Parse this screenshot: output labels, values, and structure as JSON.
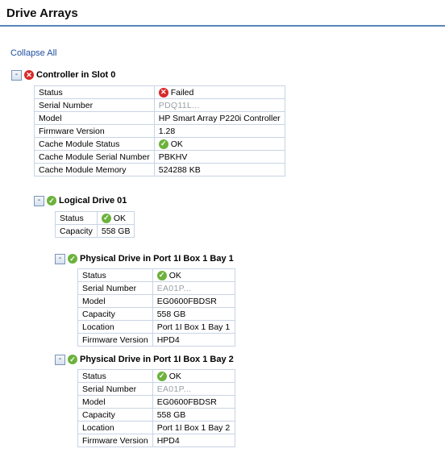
{
  "page": {
    "title": "Drive Arrays",
    "collapse_all": "Collapse All"
  },
  "controller": {
    "toggle": "-",
    "label": "Controller in Slot 0",
    "props": {
      "status_key": "Status",
      "status_val": "Failed",
      "serial_key": "Serial Number",
      "serial_val": "PDQ11L...",
      "model_key": "Model",
      "model_val": "HP Smart Array P220i Controller",
      "firmware_key": "Firmware Version",
      "firmware_val": "1.28",
      "cache_status_key": "Cache Module Status",
      "cache_status_val": "OK",
      "cache_serial_key": "Cache Module Serial Number",
      "cache_serial_val": "PBKHV",
      "cache_memory_key": "Cache Module Memory",
      "cache_memory_val": "524288 KB"
    }
  },
  "logical_drive": {
    "toggle": "-",
    "label": "Logical Drive 01",
    "props": {
      "status_key": "Status",
      "status_val": "OK",
      "capacity_key": "Capacity",
      "capacity_val": "558 GB"
    }
  },
  "physical_drives": [
    {
      "toggle": "-",
      "label": "Physical Drive in Port 1I Box 1 Bay 1",
      "props": {
        "status_key": "Status",
        "status_val": "OK",
        "serial_key": "Serial Number",
        "serial_val": "EA01P...",
        "model_key": "Model",
        "model_val": "EG0600FBDSR",
        "capacity_key": "Capacity",
        "capacity_val": "558 GB",
        "location_key": "Location",
        "location_val": "Port 1I Box 1 Bay 1",
        "firmware_key": "Firmware Version",
        "firmware_val": "HPD4"
      }
    },
    {
      "toggle": "-",
      "label": "Physical Drive in Port 1I Box 1 Bay 2",
      "props": {
        "status_key": "Status",
        "status_val": "OK",
        "serial_key": "Serial Number",
        "serial_val": "EA01P...",
        "model_key": "Model",
        "model_val": "EG0600FBDSR",
        "capacity_key": "Capacity",
        "capacity_val": "558 GB",
        "location_key": "Location",
        "location_val": "Port 1I Box 1 Bay 2",
        "firmware_key": "Firmware Version",
        "firmware_val": "HPD4"
      }
    }
  ],
  "icons": {
    "failed": "error-x-icon",
    "ok": "check-circle-icon"
  },
  "colors": {
    "failed": "#d62a2a",
    "ok": "#6cb23c",
    "accent": "#5a86b8",
    "link": "#1f4fa0"
  }
}
